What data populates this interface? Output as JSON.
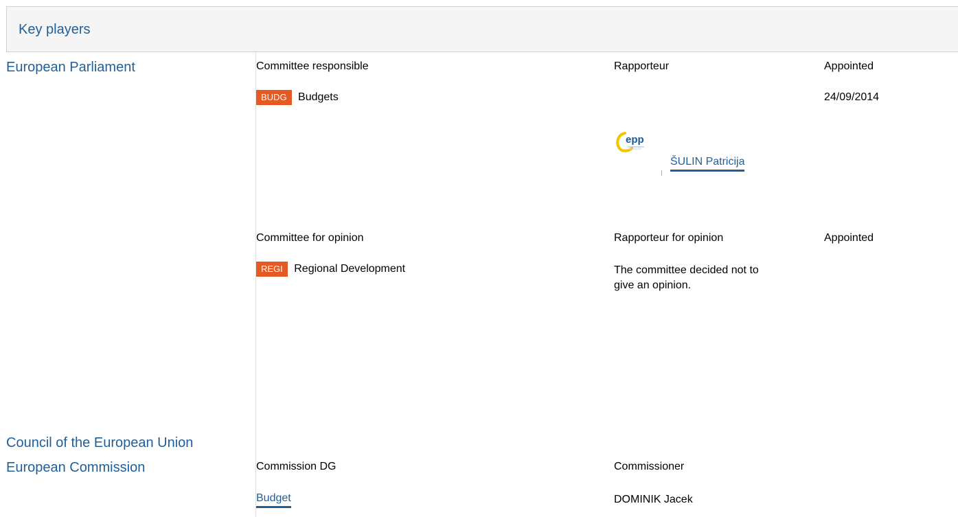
{
  "section": {
    "title": "Key players"
  },
  "parliament": {
    "name": "European Parliament",
    "responsible": {
      "col_committee": "Committee responsible",
      "col_rapporteur": "Rapporteur",
      "col_appointed": "Appointed",
      "committee_code": "BUDG",
      "committee_name": "Budgets",
      "appointed_date": "24/09/2014",
      "group_logo": "epp-logo",
      "rapporteur_name": "ŠULIN Patricija"
    },
    "opinion": {
      "col_committee": "Committee for opinion",
      "col_rapporteur": "Rapporteur for opinion",
      "col_appointed": "Appointed",
      "committee_code": "REGI",
      "committee_name": "Regional Development",
      "note": "The committee decided not to give an opinion."
    }
  },
  "council": {
    "name": "Council of the European Union"
  },
  "commission": {
    "name": "European Commission",
    "col_dg": "Commission DG",
    "col_commissioner": "Commissioner",
    "dg_name": "Budget",
    "commissioner_name": "DOMINIK Jacek"
  },
  "colors": {
    "link": "#1f5f99",
    "badge": "#e55a24",
    "header_bg": "#f5f5f5"
  }
}
